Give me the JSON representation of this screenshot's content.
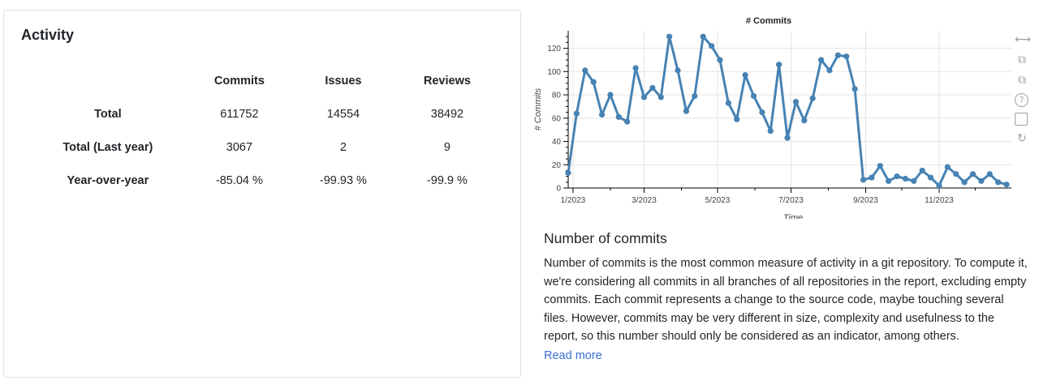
{
  "activity": {
    "title": "Activity",
    "columns": [
      "",
      "Commits",
      "Issues",
      "Reviews"
    ],
    "rows": [
      {
        "label": "Total",
        "values": [
          "611752",
          "14554",
          "38492"
        ]
      },
      {
        "label": "Total (Last year)",
        "values": [
          "3067",
          "2",
          "9"
        ]
      },
      {
        "label": "Year-over-year",
        "values": [
          "-85.04 %",
          "-99.93 %",
          "-99.9 %"
        ]
      }
    ]
  },
  "toolbar": {
    "icons": [
      "pan-icon",
      "box-zoom-icon",
      "wheel-zoom-icon",
      "help-icon",
      "save-icon",
      "reset-icon"
    ]
  },
  "description": {
    "title": "Number of commits",
    "text": "Number of commits is the most common measure of activity in a git repository. To compute it, we're considering all commits in all branches of all repositories in the report, excluding empty commits. Each commit represents a change to the source code, maybe touching several files. However, commits may be very different in size, complexity and usefulness to the report, so this number should only be considered as an indicator, among others.",
    "read_more": "Read more"
  },
  "colors": {
    "series": "#4682b4",
    "link": "#3b6fd1"
  },
  "chart_data": {
    "type": "line",
    "title": "# Commits",
    "xlabel": "Time",
    "ylabel": "# Commits",
    "x_ticks": [
      "1/2023",
      "3/2023",
      "5/2023",
      "7/2023",
      "9/2023",
      "11/2023"
    ],
    "y_ticks": [
      0,
      20,
      40,
      60,
      80,
      100,
      120
    ],
    "xlim": [
      "2022-12-28",
      "2023-12-31"
    ],
    "ylim": [
      0,
      135
    ],
    "grid": true,
    "series": [
      {
        "x": [
          "2022-12-28",
          "2023-01-04",
          "2023-01-11",
          "2023-01-18",
          "2023-01-25",
          "2023-02-01",
          "2023-02-08",
          "2023-02-15",
          "2023-02-22",
          "2023-03-01",
          "2023-03-08",
          "2023-03-15",
          "2023-03-22",
          "2023-03-29",
          "2023-04-05",
          "2023-04-12",
          "2023-04-19",
          "2023-04-26",
          "2023-05-03",
          "2023-05-10",
          "2023-05-17",
          "2023-05-24",
          "2023-05-31",
          "2023-06-07",
          "2023-06-14",
          "2023-06-21",
          "2023-06-28",
          "2023-07-05",
          "2023-07-12",
          "2023-07-19",
          "2023-07-26",
          "2023-08-02",
          "2023-08-09",
          "2023-08-16",
          "2023-08-23",
          "2023-08-30",
          "2023-09-06",
          "2023-09-13",
          "2023-09-20",
          "2023-09-27",
          "2023-10-04",
          "2023-10-11",
          "2023-10-18",
          "2023-10-25",
          "2023-11-01",
          "2023-11-08",
          "2023-11-15",
          "2023-11-22",
          "2023-11-29",
          "2023-12-06",
          "2023-12-13",
          "2023-12-20",
          "2023-12-27"
        ],
        "y": [
          13,
          64,
          101,
          91,
          63,
          80,
          61,
          57,
          103,
          78,
          86,
          78,
          130,
          101,
          66,
          79,
          130,
          122,
          110,
          73,
          59,
          97,
          79,
          65,
          49,
          106,
          43,
          74,
          58,
          77,
          110,
          101,
          114,
          113,
          85,
          7,
          9,
          19,
          6,
          10,
          8,
          6,
          15,
          9,
          2,
          18,
          12,
          5,
          12,
          6,
          12,
          5,
          3
        ]
      }
    ]
  }
}
